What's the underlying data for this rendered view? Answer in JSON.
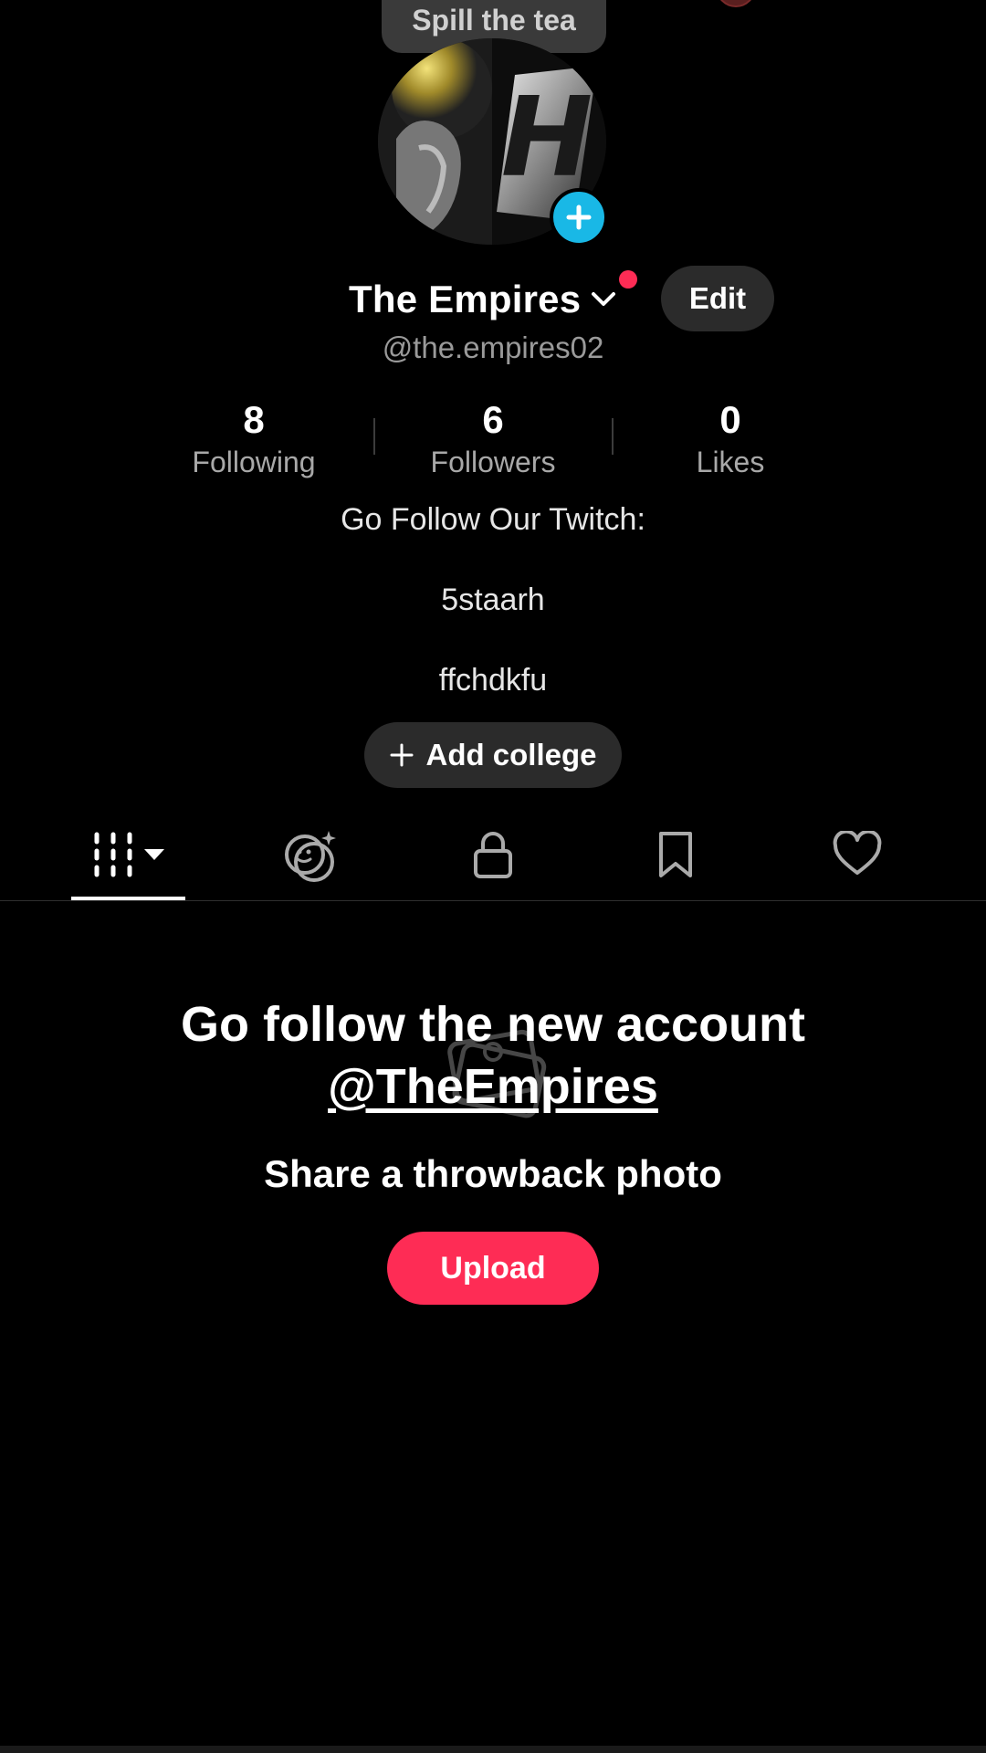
{
  "tooltip": {
    "text": "Spill the tea"
  },
  "profile": {
    "display_name": "The Empires",
    "handle": "@the.empires02",
    "edit_label": "Edit"
  },
  "stats": [
    {
      "value": "8",
      "label": "Following"
    },
    {
      "value": "6",
      "label": "Followers"
    },
    {
      "value": "0",
      "label": "Likes"
    }
  ],
  "bio": {
    "lines": [
      "Go Follow Our Twitch:",
      "5staarh",
      "ffchdkfu"
    ]
  },
  "college_button": {
    "icon": "plus",
    "label": "Add college"
  },
  "tabs": [
    {
      "icon": "grid-icon",
      "active": true
    },
    {
      "icon": "reposts-face-icon",
      "active": false
    },
    {
      "icon": "lock-icon",
      "active": false
    },
    {
      "icon": "bookmark-icon",
      "active": false
    },
    {
      "icon": "heart-icon",
      "active": false
    }
  ],
  "empty_state": {
    "promo_prefix": "Go follow the new account",
    "promo_mention": "@TheEmpires",
    "subtitle": "Share a throwback photo",
    "upload_label": "Upload"
  },
  "colors": {
    "background": "#000000",
    "accent": "#fe2c55",
    "badge_blue": "#19b8e6",
    "button_gray": "#2b2b2b"
  }
}
